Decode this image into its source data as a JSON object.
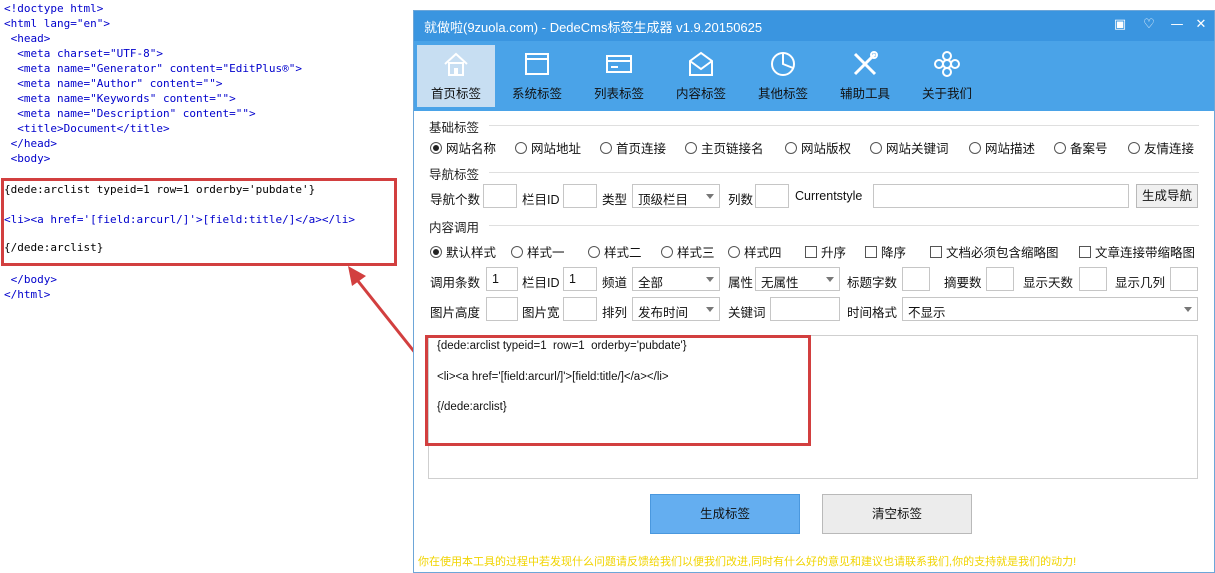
{
  "editor": {
    "lines": [
      "<!doctype html>",
      "<html lang=\"en\">",
      " <head>",
      "  <meta charset=\"UTF-8\">",
      "  <meta name=\"Generator\" content=\"EditPlus®\">",
      "  <meta name=\"Author\" content=\"\">",
      "  <meta name=\"Keywords\" content=\"\">",
      "  <meta name=\"Description\" content=\"\">",
      "  <title>Document</title>",
      " </head>",
      " <body>",
      "{dede:arclist typeid=1 row=1 orderby='pubdate'}",
      "<li><a href='[field:arcurl/]'>[field:title/]</a></li>",
      "{/dede:arclist}",
      " </body>",
      "</html>"
    ]
  },
  "window": {
    "title": "就做啦(9zuola.com) - DedeCms标签生成器 v1.9.20150625",
    "title_icons": [
      "restore-icon",
      "heart-icon",
      "minimize-icon",
      "close-icon"
    ],
    "accent_color": "#3a95e0"
  },
  "toolbar": {
    "tabs": [
      {
        "label": "首页标签",
        "icon": "home-icon",
        "active": true
      },
      {
        "label": "系统标签",
        "icon": "window-icon",
        "active": false
      },
      {
        "label": "列表标签",
        "icon": "card-icon",
        "active": false
      },
      {
        "label": "内容标签",
        "icon": "envelope-icon",
        "active": false
      },
      {
        "label": "其他标签",
        "icon": "pie-icon",
        "active": false
      },
      {
        "label": "辅助工具",
        "icon": "tools-icon",
        "active": false
      },
      {
        "label": "关于我们",
        "icon": "flower-icon",
        "active": false
      }
    ]
  },
  "basic": {
    "title": "基础标签",
    "options": [
      "网站名称",
      "网站地址",
      "首页连接",
      "主页链接名",
      "网站版权",
      "网站关键词",
      "网站描述",
      "备案号",
      "友情连接"
    ],
    "selected": "网站名称"
  },
  "nav": {
    "title": "导航标签",
    "count_label": "导航个数",
    "column_id_label": "栏目ID",
    "type_label": "类型",
    "type_value": "顶级栏目",
    "columns_label": "列数",
    "currentstyle_label": "Currentstyle",
    "generate_button": "生成导航"
  },
  "content": {
    "title": "内容调用",
    "styles": [
      "默认样式",
      "样式一",
      "样式二",
      "样式三",
      "样式四"
    ],
    "selected_style": "默认样式",
    "checkboxes": [
      "升序",
      "降序",
      "文档必须包含缩略图",
      "文章连接带缩略图"
    ],
    "row1": {
      "count_label": "调用条数",
      "count_value": "1",
      "column_id_label": "栏目ID",
      "column_id_value": "1",
      "channel_label": "频道",
      "channel_value": "全部",
      "attr_label": "属性",
      "attr_value": "无属性",
      "title_len_label": "标题字数",
      "summary_label": "摘要数",
      "days_label": "显示天数",
      "cols_label": "显示几列"
    },
    "row2": {
      "img_h_label": "图片高度",
      "img_w_label": "图片宽",
      "order_label": "排列",
      "order_value": "发布时间",
      "keyword_label": "关键词",
      "time_fmt_label": "时间格式",
      "time_fmt_value": "不显示"
    }
  },
  "output": {
    "lines": [
      "{dede:arclist typeid=1  row=1  orderby='pubdate'}",
      "<li><a href='[field:arcurl/]'>[field:title/]</a></li>",
      "{/dede:arclist}"
    ]
  },
  "actions": {
    "generate": "生成标签",
    "clear": "清空标签"
  },
  "footer": {
    "message": "你在使用本工具的过程中若发现什么问题请反馈给我们以便我们改进,同时有什么好的意见和建议也请联系我们,你的支持就是我们的动力!"
  },
  "annotation": {
    "color": "#d23f3f"
  }
}
